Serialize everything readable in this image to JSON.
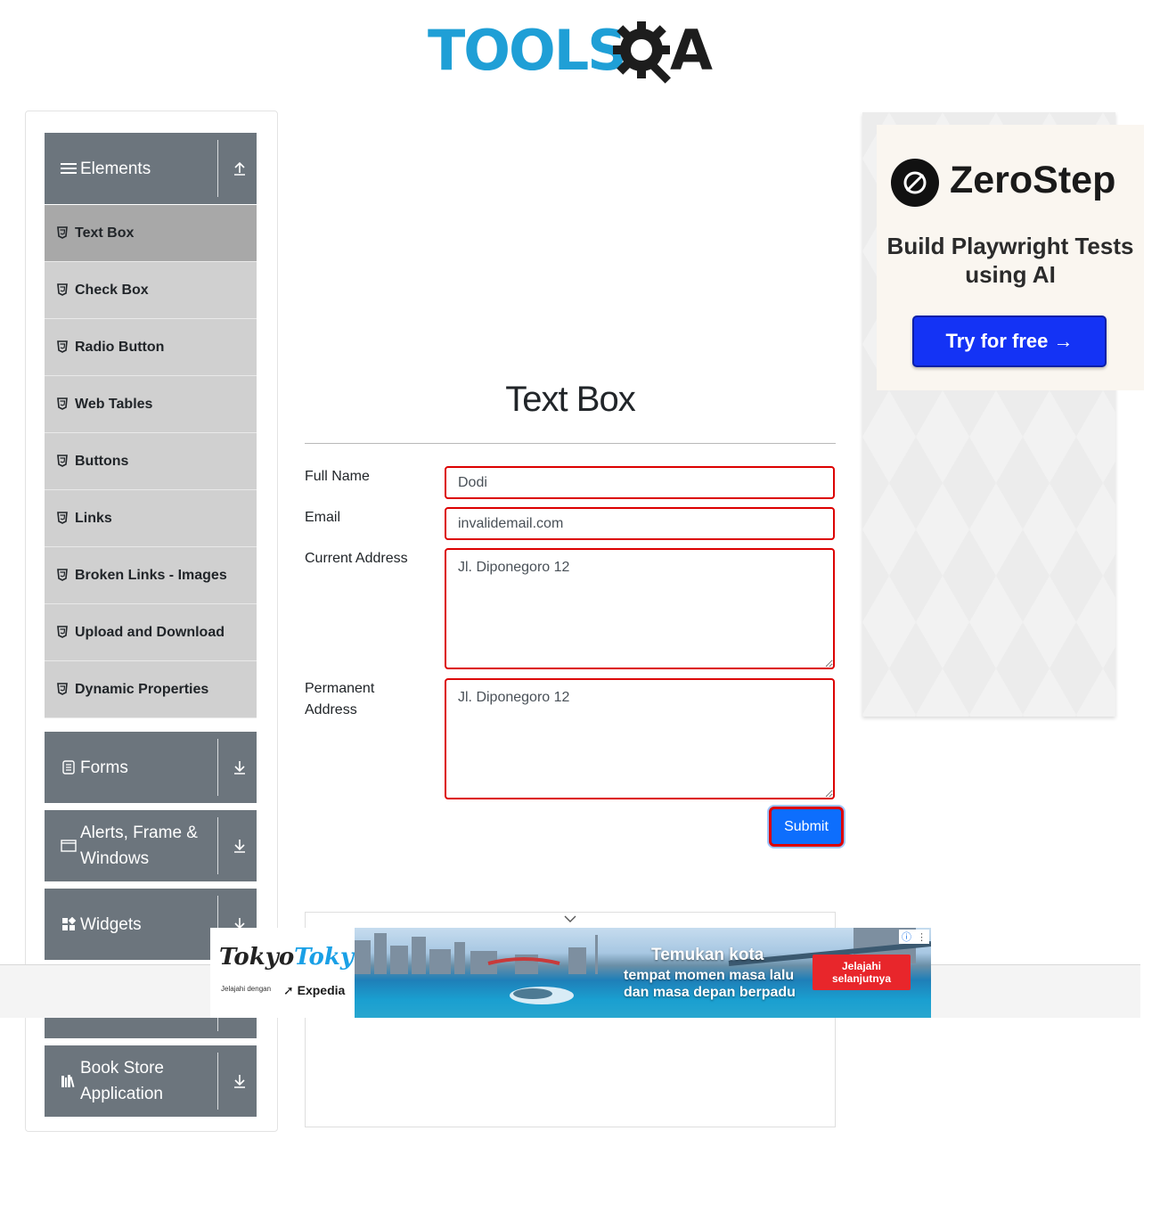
{
  "header": {
    "logo_text": "TOOLS",
    "logo_tail": "A"
  },
  "sidebar": {
    "groups": [
      {
        "label": "Elements",
        "icon": "hamburger-icon",
        "state": "expanded"
      },
      {
        "label": "Forms",
        "icon": "form-icon",
        "state": "collapsed"
      },
      {
        "label": "Alerts, Frame & Windows",
        "icon": "window-icon",
        "state": "collapsed"
      },
      {
        "label": "Widgets",
        "icon": "widgets-icon",
        "state": "collapsed"
      },
      {
        "label": "Book Store Application",
        "icon": "books-icon",
        "state": "collapsed"
      }
    ],
    "items": [
      {
        "label": "Text Box",
        "active": true
      },
      {
        "label": "Check Box"
      },
      {
        "label": "Radio Button"
      },
      {
        "label": "Web Tables"
      },
      {
        "label": "Buttons"
      },
      {
        "label": "Links"
      },
      {
        "label": "Broken Links - Images"
      },
      {
        "label": "Upload and Download"
      },
      {
        "label": "Dynamic Properties"
      }
    ]
  },
  "main": {
    "title": "Text Box",
    "form": {
      "full_name_label": "Full Name",
      "full_name_value": "Dodi",
      "email_label": "Email",
      "email_value": "invalidemail.com",
      "current_address_label": "Current Address",
      "current_address_value": "Jl. Diponegoro 12",
      "permanent_address_label": "Permanent Address",
      "permanent_address_value": "Jl. Diponegoro 12",
      "submit_label": "Submit"
    },
    "error_color": "#dc0000"
  },
  "ad_right": {
    "brand": "ZeroStep",
    "tagline": "Build Playwright Tests using AI",
    "cta": "Try for free →"
  },
  "ad_bottom": {
    "brand_part1": "Tokyo",
    "brand_part2": "Tokyo",
    "sub": "Jelajahi dengan",
    "partner": "Expedia",
    "headline": "Temukan kota",
    "subline1": "tempat momen masa lalu",
    "subline2": "dan masa depan berpadu",
    "cta": "Jelajahi selanjutnya"
  },
  "colors": {
    "accent": "#0d6efd",
    "sidebar_header": "#6c757d",
    "logo_blue": "#1f9fd6"
  }
}
